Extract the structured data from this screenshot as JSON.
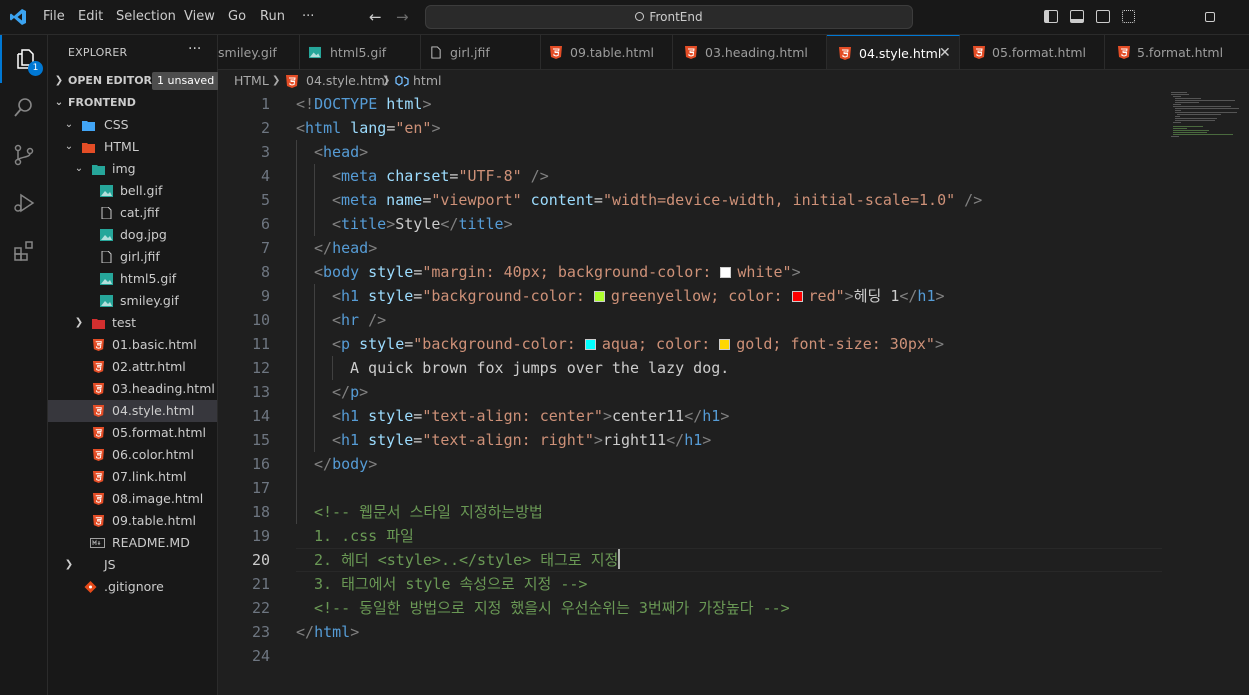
{
  "menu": {
    "file": "File",
    "edit": "Edit",
    "selection": "Selection",
    "view": "View",
    "go": "Go",
    "run": "Run",
    "more": "···"
  },
  "search": {
    "text": "FrontEnd"
  },
  "activity": {
    "explorer_badge": "1"
  },
  "sidebar": {
    "title": "EXPLORER",
    "dots": "···",
    "open_editors": "OPEN EDITORS",
    "unsaved_badge": "1 unsaved",
    "root": "FRONTEND",
    "items": [
      {
        "label": "CSS"
      },
      {
        "label": "HTML"
      },
      {
        "label": "img"
      },
      {
        "label": "bell.gif"
      },
      {
        "label": "cat.jfif"
      },
      {
        "label": "dog.jpg"
      },
      {
        "label": "girl.jfif"
      },
      {
        "label": "html5.gif"
      },
      {
        "label": "smiley.gif"
      },
      {
        "label": "test"
      },
      {
        "label": "01.basic.html"
      },
      {
        "label": "02.attr.html"
      },
      {
        "label": "03.heading.html"
      },
      {
        "label": "04.style.html"
      },
      {
        "label": "05.format.html"
      },
      {
        "label": "06.color.html"
      },
      {
        "label": "07.link.html"
      },
      {
        "label": "08.image.html"
      },
      {
        "label": "09.table.html"
      },
      {
        "label": "README.MD"
      },
      {
        "label": "JS"
      },
      {
        "label": ".gitignore"
      }
    ]
  },
  "tabs": [
    {
      "label": "smiley.gif"
    },
    {
      "label": "html5.gif"
    },
    {
      "label": "girl.jfif"
    },
    {
      "label": "09.table.html"
    },
    {
      "label": "03.heading.html"
    },
    {
      "label": "04.style.html"
    },
    {
      "label": "05.format.html"
    },
    {
      "label": "5.format.html"
    }
  ],
  "breadcrumb": {
    "part1": "HTML",
    "part2": "04.style.html",
    "part3": "html"
  },
  "code": {
    "line_numbers": [
      "1",
      "2",
      "3",
      "4",
      "5",
      "6",
      "7",
      "8",
      "9",
      "10",
      "11",
      "12",
      "13",
      "14",
      "15",
      "16",
      "17",
      "18",
      "19",
      "20",
      "21",
      "22",
      "23",
      "24"
    ],
    "l1": {
      "a": "<!",
      "b": "DOCTYPE",
      "c": " html",
      ">": ">"
    },
    "l2": {
      "open": "<",
      "tag": "html",
      "attr": " lang",
      "eq": "=",
      "val": "\"en\"",
      "close": ">"
    },
    "l3": {
      "open": "<",
      "tag": "head",
      "close": ">"
    },
    "l4": {
      "open": "<",
      "tag": "meta",
      "attr": " charset",
      "eq": "=",
      "val": "\"UTF-8\"",
      "close": " />"
    },
    "l5": {
      "open": "<",
      "tag": "meta",
      "attr": " name",
      "eq": "=",
      "val": "\"viewport\"",
      "attr2": " content",
      "eq2": "=",
      "val2": "\"width=device-width, initial-scale=1.0\"",
      "close": " />"
    },
    "l6": {
      "open": "<",
      "tag": "title",
      "close": ">",
      "text": "Style",
      "open2": "</",
      "tag2": "title",
      "close2": ">"
    },
    "l7": {
      "open": "</",
      "tag": "head",
      "close": ">"
    },
    "l8": {
      "open": "<",
      "tag": "body",
      "attr": " style",
      "eq": "=",
      "v1": "\"margin: 40px; background-color: ",
      "v2": "white\"",
      "close": ">"
    },
    "l9": {
      "open": "<",
      "tag": "h1",
      "attr": " style",
      "eq": "=",
      "v1": "\"background-color: ",
      "v2": "greenyellow; color: ",
      "v3": "red\"",
      "close": ">",
      "text": "헤딩 1",
      "open2": "</",
      "tag2": "h1",
      "close2": ">"
    },
    "l10": {
      "open": "<",
      "tag": "hr",
      "close": " />"
    },
    "l11": {
      "open": "<",
      "tag": "p",
      "attr": " style",
      "eq": "=",
      "v1": "\"background-color: ",
      "v2": "aqua; color: ",
      "v3": "gold; font-size: 30px\"",
      "close": ">"
    },
    "l12": {
      "text": "A quick brown fox jumps over the lazy dog."
    },
    "l13": {
      "open": "</",
      "tag": "p",
      "close": ">"
    },
    "l14": {
      "open": "<",
      "tag": "h1",
      "attr": " style",
      "eq": "=",
      "val": "\"text-align: center\"",
      "close": ">",
      "text": "center11",
      "open2": "</",
      "tag2": "h1",
      "close2": ">"
    },
    "l15": {
      "open": "<",
      "tag": "h1",
      "attr": " style",
      "eq": "=",
      "val": "\"text-align: right\"",
      "close": ">",
      "text": "right11",
      "open2": "</",
      "tag2": "h1",
      "close2": ">"
    },
    "l16": {
      "open": "</",
      "tag": "body",
      "close": ">"
    },
    "l18": "<!-- 웹문서 스타일 지정하는방법",
    "l19": "1. .css 파일",
    "l20": "2. 헤더 <style>..</style> 태그로 지정",
    "l21": "3. 태그에서 style 속성으로 지정 -->",
    "l22": "<!-- 동일한 방법으로 지정 했을시 우선순위는 3번째가 가장높다 -->",
    "l23": {
      "open": "</",
      "tag": "html",
      "close": ">"
    }
  },
  "colors": {
    "white": "#ffffff",
    "greenyellow": "#adff2f",
    "red": "#ff0000",
    "aqua": "#00ffff",
    "gold": "#ffd700"
  }
}
